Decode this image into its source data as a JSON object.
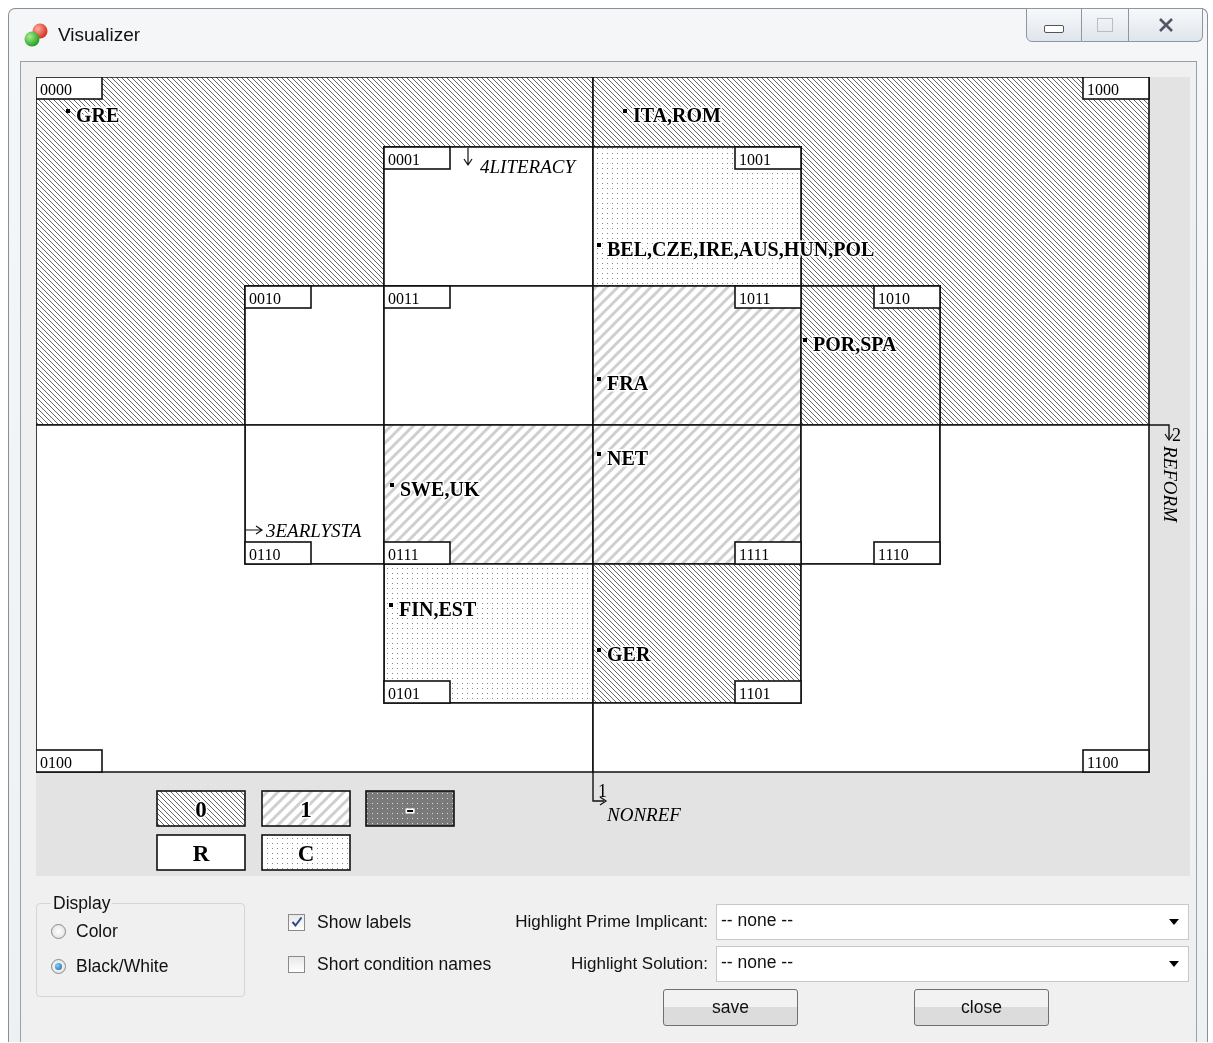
{
  "window": {
    "title": "Visualizer"
  },
  "diagram": {
    "cells": [
      {
        "code": "0000",
        "kind": "zero",
        "cases": "GRE"
      },
      {
        "code": "1000",
        "kind": "zero",
        "cases": "ITA,ROM"
      },
      {
        "code": "0001",
        "kind": "remainder"
      },
      {
        "code": "1001",
        "kind": "contradiction",
        "cases": "BEL,CZE,IRE,AUS,HUN,POL"
      },
      {
        "code": "0010",
        "kind": "remainder"
      },
      {
        "code": "0011",
        "kind": "remainder"
      },
      {
        "code": "1011",
        "kind": "one",
        "cases": "FRA"
      },
      {
        "code": "1010",
        "kind": "zero",
        "cases": "POR,SPA"
      },
      {
        "code": "0110",
        "kind": "remainder"
      },
      {
        "code": "0111",
        "kind": "one",
        "cases": "SWE,UK"
      },
      {
        "code": "1111",
        "kind": "one",
        "cases": "NET"
      },
      {
        "code": "1110",
        "kind": "remainder"
      },
      {
        "code": "0101",
        "kind": "contradiction",
        "cases": "FIN,EST"
      },
      {
        "code": "1101",
        "kind": "zero",
        "cases": "GER"
      },
      {
        "code": "0100",
        "kind": "remainder"
      },
      {
        "code": "1100",
        "kind": "remainder"
      }
    ],
    "conditions": [
      {
        "number": "1",
        "name": "NONREF"
      },
      {
        "number": "2",
        "name": "REFORM"
      },
      {
        "number": "3",
        "name": "EARLYSTA"
      },
      {
        "number": "4",
        "name": "LITERACY"
      }
    ],
    "legend": [
      {
        "label": "0",
        "kind": "zero"
      },
      {
        "label": "1",
        "kind": "one"
      },
      {
        "label": "-",
        "kind": "dontcare"
      },
      {
        "label": "R",
        "kind": "remainder"
      },
      {
        "label": "C",
        "kind": "contradiction"
      }
    ]
  },
  "display": {
    "title": "Display",
    "options": [
      {
        "label": "Color",
        "selected": false
      },
      {
        "label": "Black/White",
        "selected": true
      }
    ]
  },
  "checkboxes": [
    {
      "label": "Show labels",
      "checked": true
    },
    {
      "label": "Short condition names",
      "checked": false
    }
  ],
  "highlights": [
    {
      "label": "Highlight Prime Implicant:",
      "value": "-- none --"
    },
    {
      "label": "Highlight Solution:",
      "value": "-- none --"
    }
  ],
  "buttons": [
    "save",
    "close"
  ]
}
